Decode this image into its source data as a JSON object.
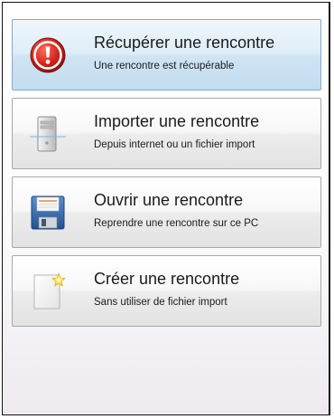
{
  "actions": [
    {
      "title": "Récupérer une rencontre",
      "subtitle": "Une rencontre est récupérable",
      "icon": "alert-icon",
      "selected": true
    },
    {
      "title": "Importer une rencontre",
      "subtitle": "Depuis internet ou un fichier import",
      "icon": "computer-tower-icon",
      "selected": false
    },
    {
      "title": "Ouvrir une rencontre",
      "subtitle": "Reprendre une rencontre sur ce PC",
      "icon": "floppy-disk-icon",
      "selected": false
    },
    {
      "title": "Créer une rencontre",
      "subtitle": "Sans utiliser de fichier import",
      "icon": "new-document-icon",
      "selected": false
    }
  ],
  "colors": {
    "alert_red": "#d7261b",
    "selected_background": "#cfe4f3",
    "selected_border": "#86a8c6",
    "button_border": "#a8a8a8"
  }
}
